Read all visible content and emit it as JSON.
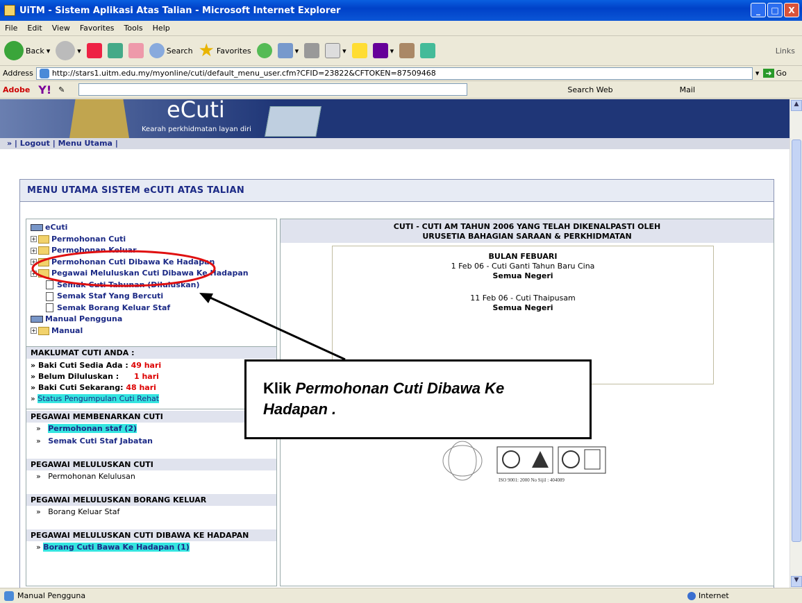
{
  "window": {
    "title": "UiTM - Sistem Aplikasi Atas Talian - Microsoft Internet Explorer",
    "minimize": "_",
    "maximize": "□",
    "close": "X"
  },
  "menu": [
    "File",
    "Edit",
    "View",
    "Favorites",
    "Tools",
    "Help"
  ],
  "toolbar": {
    "back": "Back",
    "search": "Search",
    "favorites": "Favorites",
    "links": "Links"
  },
  "address": {
    "label": "Address",
    "url": "http://stars1.uitm.edu.my/myonline/cuti/default_menu_user.cfm?CFID=23822&CFTOKEN=87509468",
    "go": "Go"
  },
  "ybar": {
    "adobe": "Adobe",
    "search_web": "Search Web",
    "mail": "Mail"
  },
  "banner": {
    "title": "eCuti",
    "subtitle": "Kearah perkhidmatan layan diri"
  },
  "nav": {
    "logout": "Logout",
    "menu_utama": "Menu Utama"
  },
  "main": {
    "heading": "MENU UTAMA SISTEM eCUTI ATAS TALIAN"
  },
  "tree": {
    "root": "eCuti",
    "items": [
      "Permohonan Cuti",
      "Permohonan Keluar",
      "Permohonan Cuti Dibawa Ke Hadapan",
      "Pegawai Meluluskan Cuti Dibawa Ke Hadapan"
    ],
    "docs": [
      "Semak Cuti Tahunan (Diluluskan)",
      "Semak Staf Yang Bercuti",
      "Semak Borang Keluar Staf"
    ],
    "manual_root": "Manual Pengguna",
    "manual": "Manual"
  },
  "info": {
    "heading": "MAKLUMAT CUTI ANDA :",
    "rows": [
      {
        "label": "Baki Cuti Sedia Ada :",
        "value": "49 hari"
      },
      {
        "label": "Belum Diluluskan :",
        "value": "1 hari"
      },
      {
        "label": "Baki Cuti Sekarang:",
        "value": "48 hari"
      }
    ],
    "status": "Status Pengumpulan Cuti Rehat"
  },
  "sections": [
    {
      "heading": "PEGAWAI MEMBENARKAN CUTI",
      "items": [
        "Permohonan staf (2)",
        "Semak Cuti Staf Jabatan"
      ]
    },
    {
      "heading": "PEGAWAI MELULUSKAN CUTI",
      "items": [
        "Permohonan Kelulusan"
      ]
    },
    {
      "heading": "PEGAWAI MELULUSKAN BORANG KELUAR",
      "items": [
        "Borang Keluar Staf"
      ]
    },
    {
      "heading": "PEGAWAI MELULUSKAN CUTI DIBAWA KE HADAPAN",
      "items": [
        "Borang Cuti Bawa Ke Hadapan  (1)"
      ]
    }
  ],
  "holidays": {
    "heading1": "CUTI - CUTI AM TAHUN 2006 YANG TELAH DIKENALPASTI OLEH",
    "heading2": "URUSETIA BAHAGIAN SARAAN & PERKHIDMATAN",
    "month": "BULAN FEBUARI",
    "entries": [
      {
        "date": "1 Feb 06 - Cuti Ganti Tahun Baru Cina",
        "scope": "Semua Negeri"
      },
      {
        "date": "11 Feb 06 - Cuti Thaipusam",
        "scope": "Semua Negeri"
      }
    ]
  },
  "iso": "ISO 9001: 2000  No Sijil : 404089",
  "callout": {
    "prefix": "Klik ",
    "italic": "Permohonan Cuti Dibawa Ke Hadapan ."
  },
  "status": {
    "left": "Manual Pengguna",
    "zone": "Internet"
  }
}
